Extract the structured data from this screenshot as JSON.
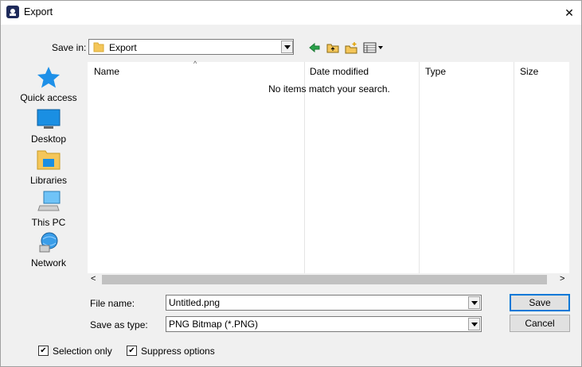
{
  "window": {
    "title": "Export",
    "close_glyph": "✕"
  },
  "save_in": {
    "label": "Save in:",
    "value": "Export"
  },
  "places": [
    {
      "label": "Quick access",
      "icon": "star-icon"
    },
    {
      "label": "Desktop",
      "icon": "desktop-icon"
    },
    {
      "label": "Libraries",
      "icon": "libraries-icon"
    },
    {
      "label": "This PC",
      "icon": "computer-icon"
    },
    {
      "label": "Network",
      "icon": "network-icon"
    }
  ],
  "file_list": {
    "columns": [
      "Name",
      "Date modified",
      "Type",
      "Size"
    ],
    "empty_message": "No items match your search.",
    "sort_glyph": "^",
    "scroll_left": "<",
    "scroll_right": ">"
  },
  "file_name": {
    "label": "File name:",
    "value": "Untitled.png"
  },
  "save_as_type": {
    "label": "Save as type:",
    "value": "PNG Bitmap (*.PNG)"
  },
  "buttons": {
    "save": "Save",
    "cancel": "Cancel"
  },
  "options": [
    {
      "label": "Selection only",
      "checked": true
    },
    {
      "label": "Suppress options",
      "checked": true
    }
  ],
  "check_glyph": "✔",
  "colors": {
    "accent": "#0078d7",
    "folder": "#f4c65a",
    "star": "#1e90e8"
  }
}
